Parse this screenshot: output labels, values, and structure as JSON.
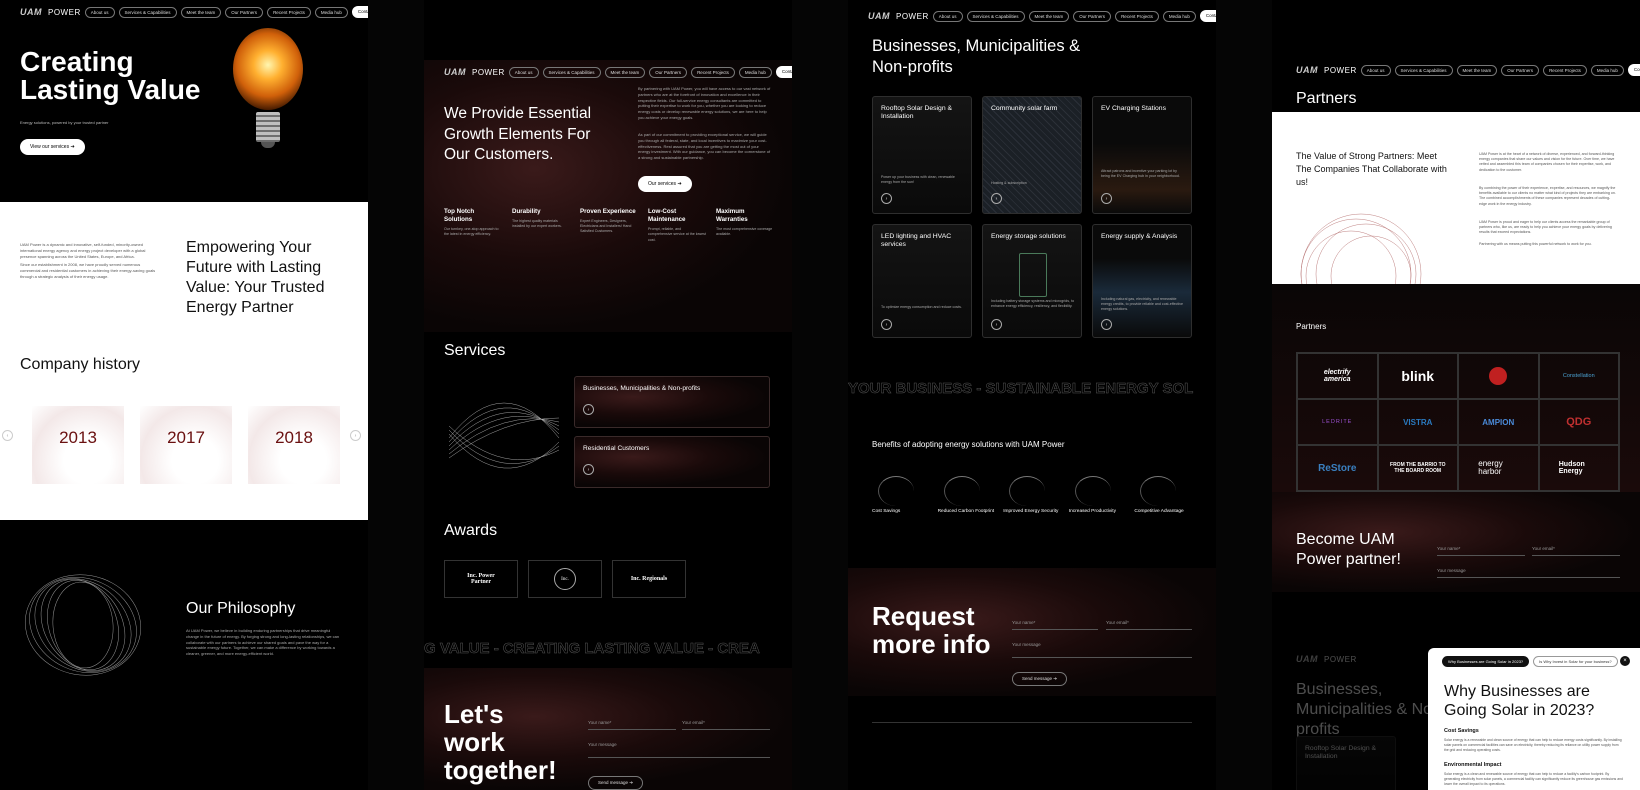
{
  "logo": {
    "brand": "POWER",
    "mark": "UAM"
  },
  "nav": {
    "items": [
      "About us",
      "Services & Capabilities",
      "Meet the team",
      "Our Partners",
      "Recent Projects",
      "Media hub"
    ],
    "contact": "Contact us ➔"
  },
  "hero": {
    "title_l1": "Creating",
    "title_l2": "Lasting Value",
    "subtitle": "Energy solutions, powered by your trusted partner",
    "cta": "View our services ➔"
  },
  "empower": {
    "p1": "UAM Power is a dynamic and innovative, self-funded, minority-owned international energy agency and energy project developer with a global presence spanning across the United States, Europe, and Africa.",
    "p2": "Since our establishment in 2008, we have proudly served numerous commercial and residential customers in achieving their energy-saving goals through a strategic analysis of their energy usage.",
    "title": "Empowering Your Future with Lasting Value: Your Trusted Energy Partner"
  },
  "history": {
    "title": "Company history",
    "years": [
      "2013",
      "2017",
      "2018"
    ]
  },
  "philosophy": {
    "title": "Our Philosophy",
    "body": "At UAM Power, we believe in building enduring partnerships that drive meaningful change in the future of energy. By forging strong and long-lasting relationships, we can collaborate with our partners to achieve our shared goals and pave the way for a sustainable energy future. Together, we can make a difference by working towards a cleaner, greener, and more energy-efficient world."
  },
  "provide": {
    "title": "We Provide Essential Growth Elements For Our Customers.",
    "p1": "By partnering with UAM Power, you will have access to our vast network of partners who are at the forefront of innovation and excellence in their respective fields. Our full-service energy consultants are committed to putting their expertise to work for you, whether you are looking to reduce energy costs or develop renewable energy solutions, we are here to help you achieve your energy goals.",
    "p2": "As part of our commitment to providing exceptional service, we will guide you through all federal, state, and local incentives to maximize your cost-effectiveness. Rest assured that you are getting the most out of your energy investment. With our guidance, you can become the cornerstone of a strong and sustainable partnership.",
    "cta": "Our services ➔"
  },
  "features": [
    {
      "t": "Top Notch Solutions",
      "d": "Our turnkey, one-stop approach to the latest in energy efficiency."
    },
    {
      "t": "Durability",
      "d": "The highest quality materials installed by our expert workers."
    },
    {
      "t": "Proven Experience",
      "d": "Expert Engineers, Designers, Electricians and Installers! Hand Satisfied Customers."
    },
    {
      "t": "Low-Cost Maintenance",
      "d": "Prompt, reliable, and comprehensive service at the lowest cost."
    },
    {
      "t": "Maximum Warranties",
      "d": "The most comprehensive coverage available."
    }
  ],
  "services": {
    "title": "Services",
    "items": [
      "Businesses, Municipalities & Non-profits",
      "Residential Customers"
    ]
  },
  "awards": {
    "title": "Awards",
    "items": [
      "Inc. Power Partner",
      "Inc.",
      "Inc. Regionals"
    ]
  },
  "marquee1": "G VALUE - CREATING LASTING VALUE - CREA",
  "work": {
    "title_l1": "Let's",
    "title_l2": "work",
    "title_l3": "together!",
    "name": "Your name*",
    "email": "Your email*",
    "message": "Your message",
    "send": "Send message ➔"
  },
  "biz": {
    "title": "Businesses, Municipalities & Non-profits",
    "cards": [
      {
        "t": "Rooftop Solar Design & Installation",
        "d": "Power up your business with clean, renewable energy from the sun!"
      },
      {
        "t": "Community solar farm",
        "d": "Hosting & subscription"
      },
      {
        "t": "EV Charging Stations",
        "d": "Attract patrons and incentive your parking lot by being the EV Charging hub in your neighborhood."
      },
      {
        "t": "LED lighting and HVAC services",
        "d": "To optimize energy consumption and reduce costs."
      },
      {
        "t": "Energy storage solutions",
        "d": "Including battery storage systems and microgrids, to enhance energy efficiency, resiliency, and flexibility."
      },
      {
        "t": "Energy supply & Analysis",
        "d": "Including natural gas, electricity, and renewable energy credits, to provide reliable and cost-effective energy solutions."
      }
    ]
  },
  "marquee2": "YOUR BUSINESS - SUSTAINABLE ENERGY SOL",
  "benefits": {
    "title": "Benefits of adopting energy solutions with UAM Power",
    "items": [
      "Cost Savings",
      "Reduced Carbon Footprint",
      "Improved Energy Security",
      "Increased Productivity",
      "Competitive Advantage"
    ]
  },
  "request": {
    "title_l1": "Request",
    "title_l2": "more info",
    "name": "Your name*",
    "email": "Your email*",
    "message": "Your message",
    "send": "Send message ➔"
  },
  "partners": {
    "title": "Partners",
    "heading": "The Value of Strong Partners: Meet The Companies That Collaborate with us!",
    "p1": "UAM Power is at the heart of a network of diverse, experienced, and forward-thinking energy companies that share our values and vision for the future. Over time, we have vetted and assembled this team of companies chosen for their expertise, work, and dedication to the customer.",
    "p2": "By combining the power of their experience, expertise, and resources, we magnify the benefits available to our clients no matter what kind of projects they are embarking on. The combined accomplishments of these companies represent decades of cutting-edge work in the energy industry.",
    "p3": "UAM Power is proud and eager to help our clients access the remarkable group of partners who, like us, are ready to help you achieve your energy goals by delivering results that exceed expectations.",
    "p4": "Partnering with us means putting this powerful network to work for you.",
    "sub": "Partners",
    "logos": [
      "electrify america",
      "blink",
      "",
      "Constellation",
      "LEDRITE",
      "VISTRA",
      "AMPION",
      "QDG",
      "ReStore",
      "FROM THE BARRIO TO THE BOARD ROOM",
      "energy harbor",
      "Hudson Energy"
    ]
  },
  "become": {
    "title": "Become UAM Power partner!",
    "name": "Your name*",
    "email": "Your email*",
    "message": "Your message"
  },
  "faded": {
    "title": "Businesses, Municipalities & Non-profits",
    "card": "Rooftop Solar Design & Installation"
  },
  "solar": {
    "tab1": "Why Businesses are Going Solar in 2023?",
    "tab2": "Is Why Invest in Solar for your business?",
    "title": "Why Businesses are Going Solar in 2023?",
    "s1": "Cost Savings",
    "p1": "Solar energy is a renewable and clean source of energy that can help to reduce energy costs significantly. By installing solar panels on commercial facilities can save on electricity, thereby reducing its reliance on utility power supply from the grid and reducing operating costs.",
    "s2": "Environmental Impact",
    "p2": "Solar energy is a clean and renewable source of energy that can help to reduce a facility's carbon footprint. By generating electricity from solar panels, a commercial facility can significantly reduce its greenhouse gas emissions and lower the overall impact to its operations."
  }
}
